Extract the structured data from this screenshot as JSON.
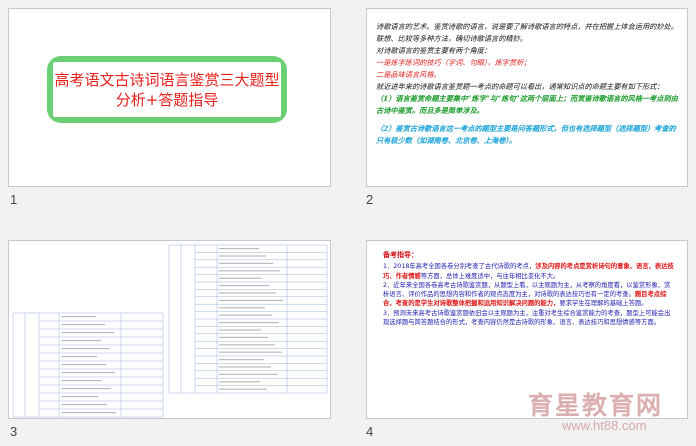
{
  "slide_numbers": [
    "1",
    "2",
    "3",
    "4"
  ],
  "slide1": {
    "title_line1": "高考语文古诗词语言鉴赏三大题型",
    "title_line2": "分析+答题指导"
  },
  "slide2": {
    "p1": "诗歌语言的艺术。鉴赏诗歌的语言，说是要了解诗歌语言的特点，并在把握上体会运用的妙处。联想、比较等多种方法，确切诗歌语言的精妙。",
    "p2": "对诗歌语言的鉴赏主要有两个角度：",
    "r1": "一是炼字炼词的技巧（字词、句眼），炼字赏析；",
    "r2": "二是品味语言风格。",
    "p3": "就近进年来的诗歌语言鉴赏题一考点的命题可以看出，通常知识点的命题主要有如下形式：",
    "g1": "（1）语言鉴赏命题主要集中“炼字”与“炼句”这两个层面上；而赏鉴诗歌语言的风格一考点则由古诗中鉴赏。而且多是简单涉及。",
    "b1": "（2）鉴赏古诗歌语言这一考点的题型主要是问答题形式，但也有选择题型（选择题型）考查的只有极少数（如湖南卷、北京卷、上海卷）。"
  },
  "slide3": {
    "left_rows": [
      "",
      "",
      "",
      "",
      "",
      "",
      "",
      "",
      "",
      "",
      "",
      "",
      ""
    ],
    "right_rows": [
      "",
      "",
      "",
      "",
      "",
      "",
      "",
      "",
      "",
      "",
      "",
      "",
      "",
      "",
      "",
      "",
      "",
      "",
      "",
      ""
    ]
  },
  "slide4": {
    "heading": "备考指导：",
    "l1a": "1．2018年高考全国各卷分别考查了古代诗歌的考点，",
    "l1b": "涉及内容的考点是赏析诗句的意象、语言、表达技巧、作者情感",
    "l1c": "等方面，总体上难度适中，与往年相比变化不大。",
    "l2a": "2．近年来全国各卷高考古诗歌鉴赏题，从题型上看，以主观题为主，从考察的角度看，以鉴赏形象、赏析语言、评价作品的思想内容和作者的观点态度为主，对诗歌的表达技巧也有一定的考查。",
    "l2b": "题目考点综合，考查的是学生对诗歌整体把握和运用知识解决问题的能力，",
    "l2c": "要求学生在理解的基础上答题。",
    "l3a": "3．预测未来高考古诗歌鉴赏题依旧会以主观题为主，注重对考生综合鉴赏能力的考查，题型上可能会出现选择题与简答题结合的形式，考查内容仍然是古诗歌的形象、语言、表达技巧和思想情感等方面。"
  },
  "watermark": {
    "text": "育星教育网",
    "url": "www.ht88.com"
  }
}
